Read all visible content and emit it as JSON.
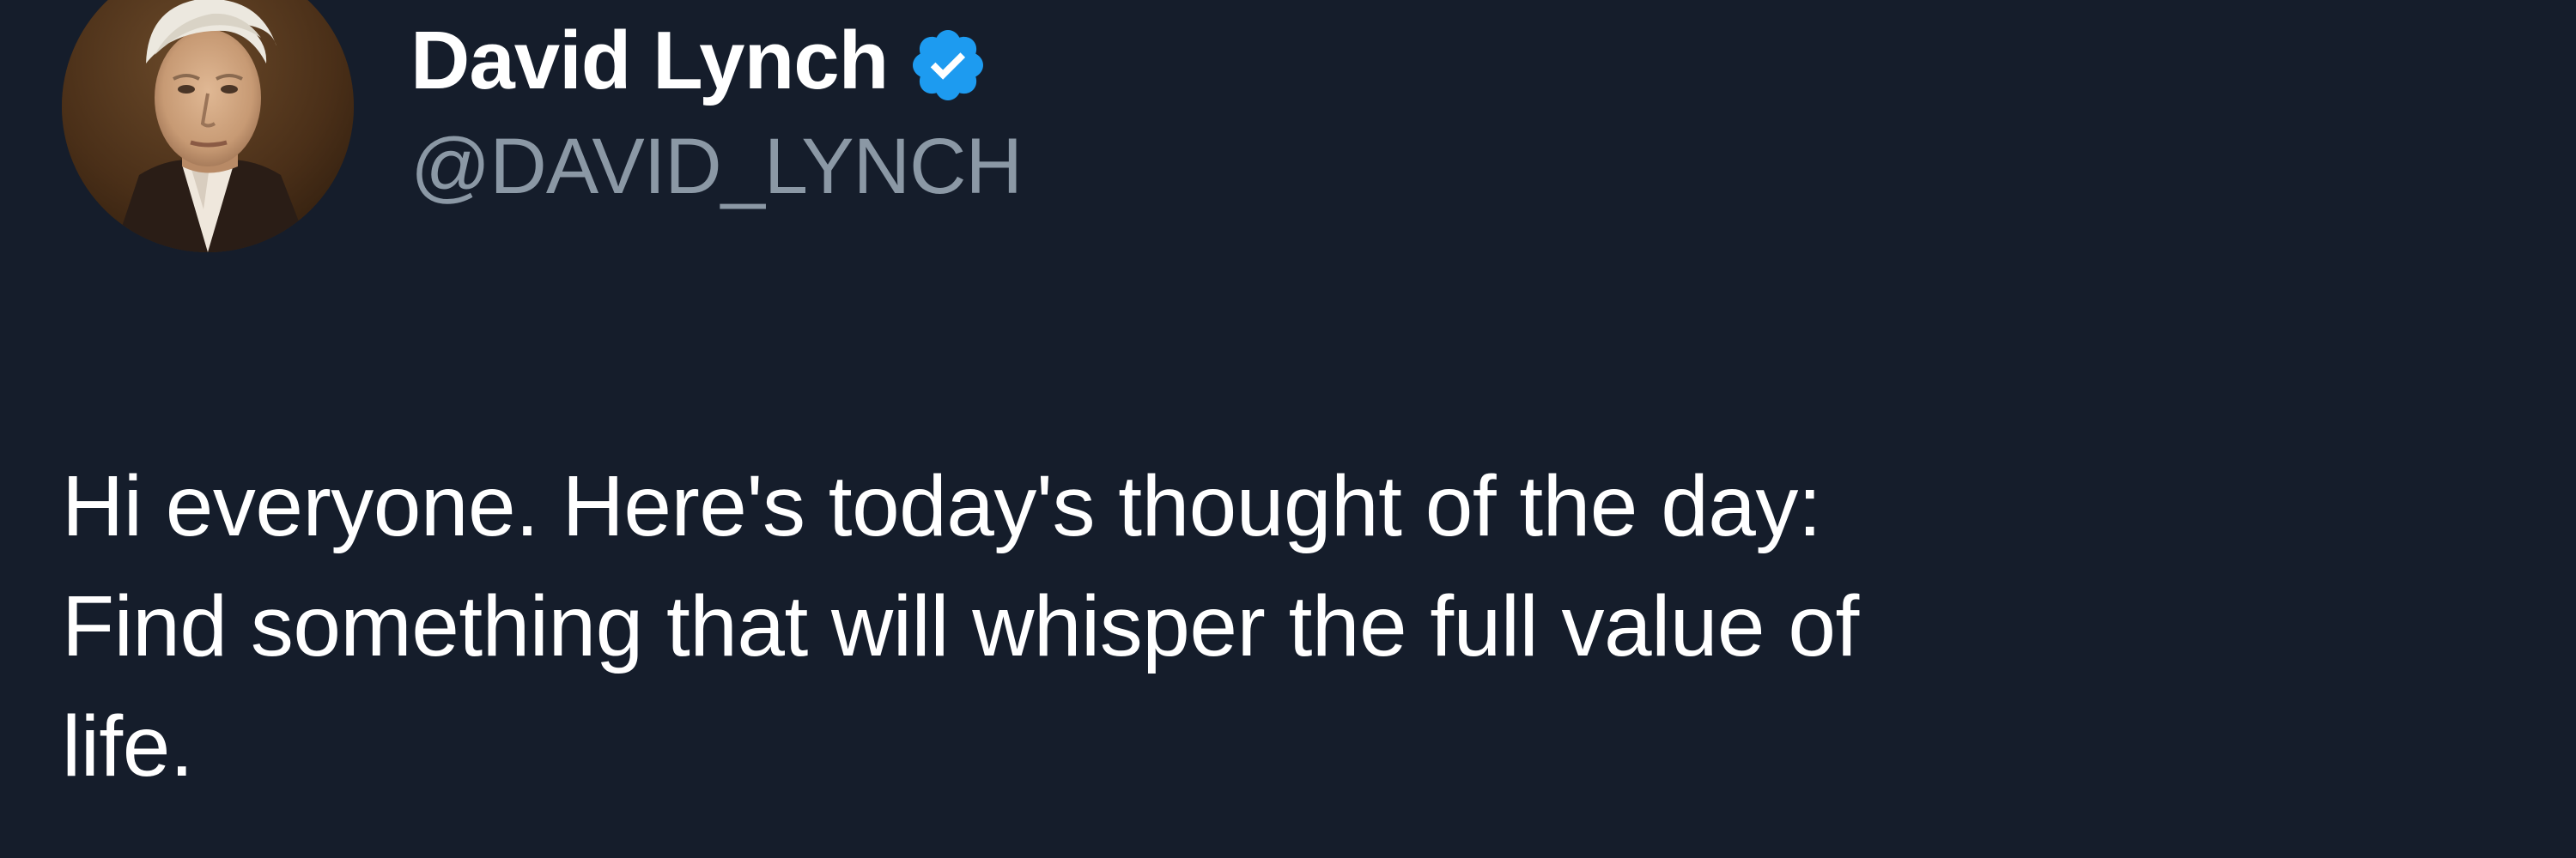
{
  "author": {
    "display_name": "David Lynch",
    "handle": "@DAVID_LYNCH",
    "verified": true,
    "verified_badge_icon": "verified-check-icon",
    "avatar_icon": "profile-photo"
  },
  "tweet": {
    "text": "Hi everyone. Here's today's thought of the day:\nFind something that will whisper the full value of\nlife."
  },
  "colors": {
    "background": "#151d2b",
    "text_primary": "#ffffff",
    "text_secondary": "#8b98a5",
    "verified_blue": "#1d9bf0"
  }
}
